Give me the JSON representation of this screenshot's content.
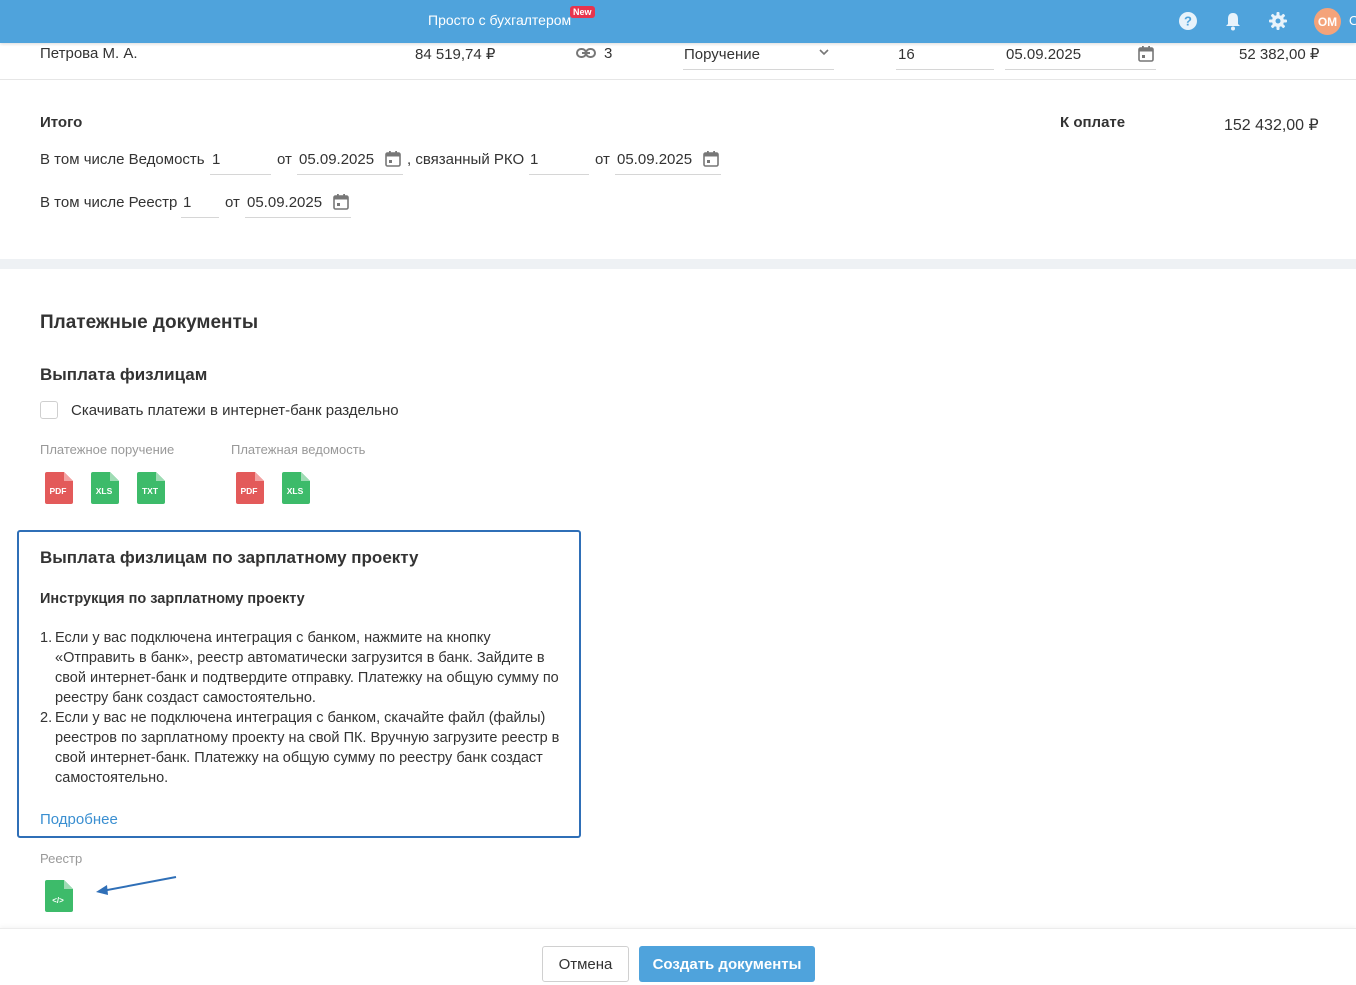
{
  "topbar": {
    "promo": "Просто с бухгалтером",
    "new_badge": "New",
    "icons": [
      "help-icon",
      "bell-icon",
      "gear-icon"
    ],
    "avatar_initials": "ОМ",
    "avatar_cut": "О"
  },
  "employee_row": {
    "name": "Петрова М. А.",
    "amount": "84 519,74 ₽",
    "links_count": "3",
    "doc_type": "Поручение",
    "doc_number": "16",
    "doc_date": "05.09.2025",
    "to_pay": "52 382,00 ₽"
  },
  "totals": {
    "title": "Итого",
    "to_pay_label": "К оплате",
    "to_pay_value": "152 432,00 ₽",
    "vedomost_label": "В том числе Ведомость",
    "vedomost_number": "1",
    "from_label": "от",
    "vedomost_date": "05.09.2025",
    "rko_label": ", связанный РКО",
    "rko_number": "1",
    "rko_date": "05.09.2025",
    "reestr_label": "В том числе Реестр",
    "reestr_number": "1",
    "reestr_date": "05.09.2025"
  },
  "payments": {
    "section_title": "Платежные документы",
    "individuals_title": "Выплата физлицам",
    "download_separately": "Скачивать платежи в интернет-банк раздельно",
    "order_label": "Платежное поручение",
    "order_formats": [
      "PDF",
      "XLS",
      "TXT"
    ],
    "statement_label": "Платежная ведомость",
    "statement_formats": [
      "PDF",
      "XLS"
    ]
  },
  "salary_project": {
    "title": "Выплата физлицам по зарплатному проекту",
    "instruction_title": "Инструкция по зарплатному проекту",
    "steps": [
      {
        "num": "1.",
        "text": "Если у вас подключена интеграция с банком, нажмите на кнопку «Отправить в банк», реестр автоматически загрузится в банк. Зайдите в свой интернет-банк и подтвердите отправку. Платежку на общую сумму по реестру банк создаст самостоятельно."
      },
      {
        "num": "2.",
        "text": "Если у вас не подключена интеграция с банком, скачайте файл (файлы) реестров по зарплатному проекту на свой ПК. Вручную загрузите реестр в свой интернет-банк. Платежку на общую сумму по реестру банк создаст самостоятельно."
      }
    ],
    "more_link": "Подробнее",
    "registry_label": "Реестр",
    "registry_format": "</>"
  },
  "footer": {
    "cancel": "Отмена",
    "create": "Создать документы"
  },
  "colors": {
    "topbar": "#4fa3dc",
    "pdf": "#e35a5a",
    "green_file": "#3dbb6a",
    "panel_border": "#2f6fb7",
    "link": "#3a8fd1"
  }
}
